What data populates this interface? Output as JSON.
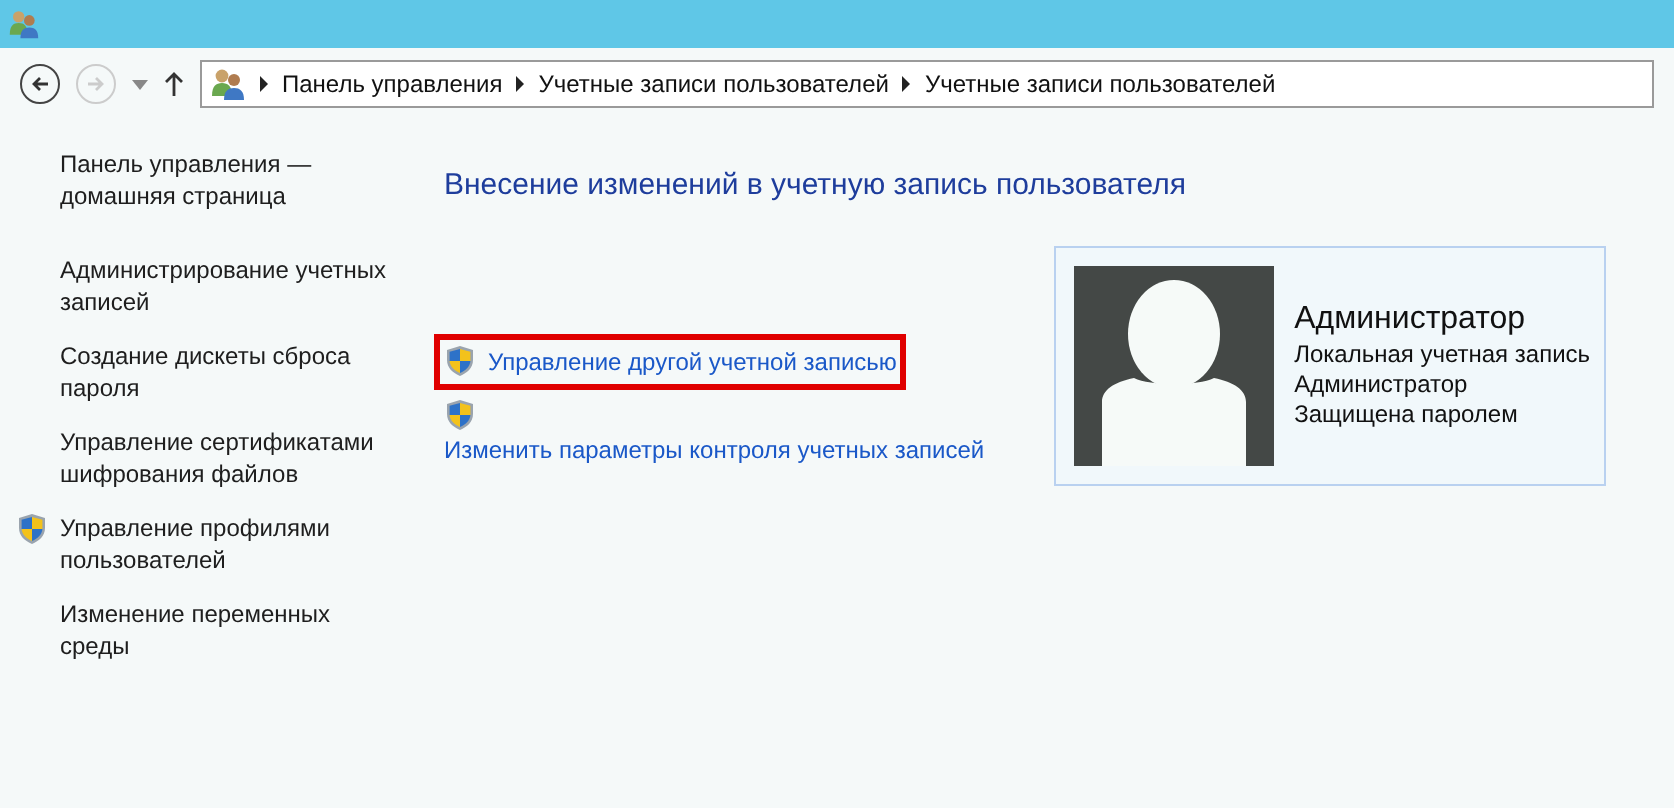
{
  "nav": {
    "back_disabled": false,
    "forward_disabled": true
  },
  "breadcrumbs": [
    "Панель управления",
    "Учетные записи пользователей",
    "Учетные записи пользователей"
  ],
  "sidebar": {
    "items": [
      {
        "label": "Панель управления — домашняя страница",
        "shielded": false
      },
      {
        "label": "Администрирование учетных записей",
        "shielded": false
      },
      {
        "label": "Создание дискеты сброса пароля",
        "shielded": false
      },
      {
        "label": "Управление сертификатами шифрования файлов",
        "shielded": false
      },
      {
        "label": "Управление профилями пользователей",
        "shielded": true
      },
      {
        "label": "Изменение переменных среды",
        "shielded": false
      }
    ]
  },
  "heading": "Внесение изменений в учетную запись пользователя",
  "tasks": [
    {
      "label": "Управление другой учетной записью",
      "kind": "inline",
      "highlighted": true
    },
    {
      "label": "Изменить параметры контроля учетных записей",
      "kind": "stacked",
      "highlighted": false
    }
  ],
  "account": {
    "name": "Администратор",
    "lines": [
      "Локальная учетная запись",
      "Администратор",
      "Защищена паролем"
    ]
  }
}
